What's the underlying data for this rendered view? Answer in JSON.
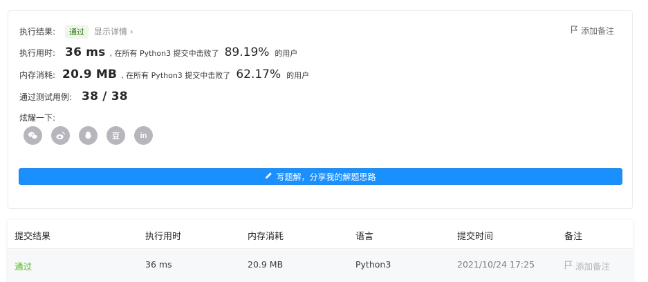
{
  "result": {
    "label": "执行结果:",
    "status": "通过",
    "detail_link": "显示详情 ›",
    "add_note": "添加备注"
  },
  "runtime": {
    "label": "执行用时:",
    "value": "36 ms",
    "prefix": ", 在所有 Python3 提交中击败了",
    "percent": "89.19%",
    "suffix": "的用户"
  },
  "memory": {
    "label": "内存消耗:",
    "value": "20.9 MB",
    "prefix": ", 在所有 Python3 提交中击败了",
    "percent": "62.17%",
    "suffix": "的用户"
  },
  "testcases": {
    "label": "通过测试用例:",
    "value": "38 / 38"
  },
  "share": {
    "label": "炫耀一下:",
    "icons": [
      "wechat-icon",
      "weibo-icon",
      "qq-icon",
      "douban-icon",
      "linkedin-icon"
    ],
    "douban_text": "豆",
    "linkedin_text": "in"
  },
  "write_button": "写题解，分享我的解题思路",
  "table": {
    "headers": [
      "提交结果",
      "执行用时",
      "内存消耗",
      "语言",
      "提交时间",
      "备注"
    ],
    "row": {
      "result": "通过",
      "runtime": "36 ms",
      "memory": "20.9 MB",
      "language": "Python3",
      "time": "2021/10/24 17:25",
      "note": "添加备注"
    }
  },
  "colors": {
    "accent": "#1a90ff",
    "success": "#5cb82b",
    "share_icon_bg": "#b6b6bc"
  }
}
